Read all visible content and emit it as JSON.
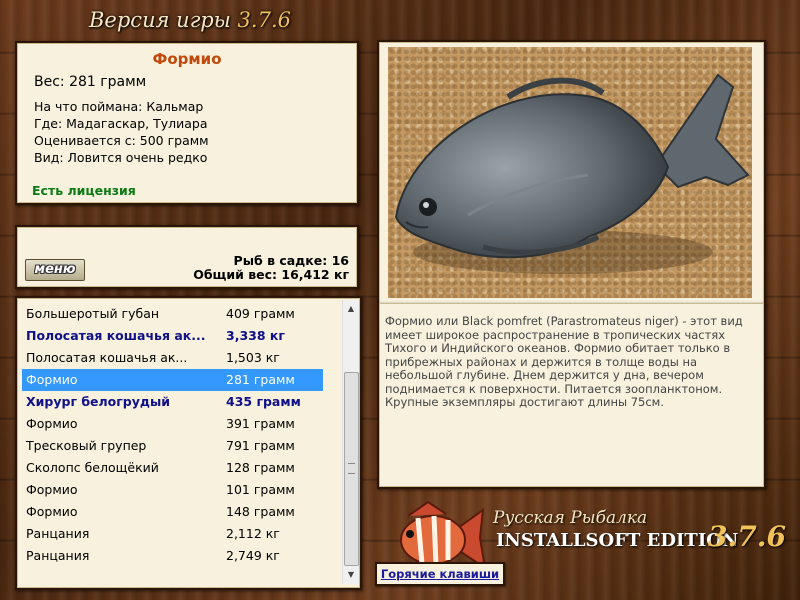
{
  "header": {
    "title": "Версия игры",
    "version": "3.7.6"
  },
  "fish_info": {
    "name": "Формио",
    "weight": "Вес: 281 грамм",
    "caught_on": "На что поймана: Кальмар",
    "location": "Где: Мадагаскар, Тулиара",
    "valued_from": "Оценивается с: 500 грамм",
    "rarity": "Вид: Ловится очень редко",
    "license": "Есть лицензия"
  },
  "keepnet": {
    "menu_label": "меню",
    "fish_count": "Рыб в садке: 16",
    "total_weight": "Общий вес: 16,412 кг"
  },
  "fish_list": [
    {
      "name": "Большеротый губан",
      "weight": "409 грамм",
      "style": "normal"
    },
    {
      "name": "Полосатая кошачья ак...",
      "weight": "3,338 кг",
      "style": "bold"
    },
    {
      "name": "Полосатая кошачья ак...",
      "weight": "1,503 кг",
      "style": "normal"
    },
    {
      "name": "Формио",
      "weight": "281 грамм",
      "style": "selected"
    },
    {
      "name": "Хирург белогрудый",
      "weight": "435 грамм",
      "style": "bold"
    },
    {
      "name": "Формио",
      "weight": "391 грамм",
      "style": "normal"
    },
    {
      "name": "Тресковый групер",
      "weight": "791 грамм",
      "style": "normal"
    },
    {
      "name": "Сколопс белощёкий",
      "weight": "128 грамм",
      "style": "normal"
    },
    {
      "name": "Формио",
      "weight": "101 грамм",
      "style": "normal"
    },
    {
      "name": "Формио",
      "weight": "148 грамм",
      "style": "normal"
    },
    {
      "name": "Ранцания",
      "weight": "2,112 кг",
      "style": "normal"
    },
    {
      "name": "Ранцания",
      "weight": "2,749 кг",
      "style": "normal"
    }
  ],
  "description": "Формио или Black pomfret (Parastromateus niger) - этот вид имеет широкое распространение в тропических частях Тихого и Индийского океанов. Формио обитает только в прибрежных районах и держится в толще воды на небольшой глубине. Днем держится у дна, вечером поднимается к поверхности. Питается зоопланктоном. Крупные экземпляры достигают длины 75см.",
  "logo": {
    "line1": "Русская Рыбалка",
    "line2": "INSTALLSOFT EDITION",
    "version": "3.7.6"
  },
  "hotkeys_label": "Горячие клавиши",
  "icons": {
    "scroll_up": "triangle-up",
    "scroll_down": "triangle-down"
  },
  "colors": {
    "name": "#c0480a",
    "license": "#0c7a14",
    "bold_row": "#10108a",
    "selected_row": "#3399ff"
  }
}
